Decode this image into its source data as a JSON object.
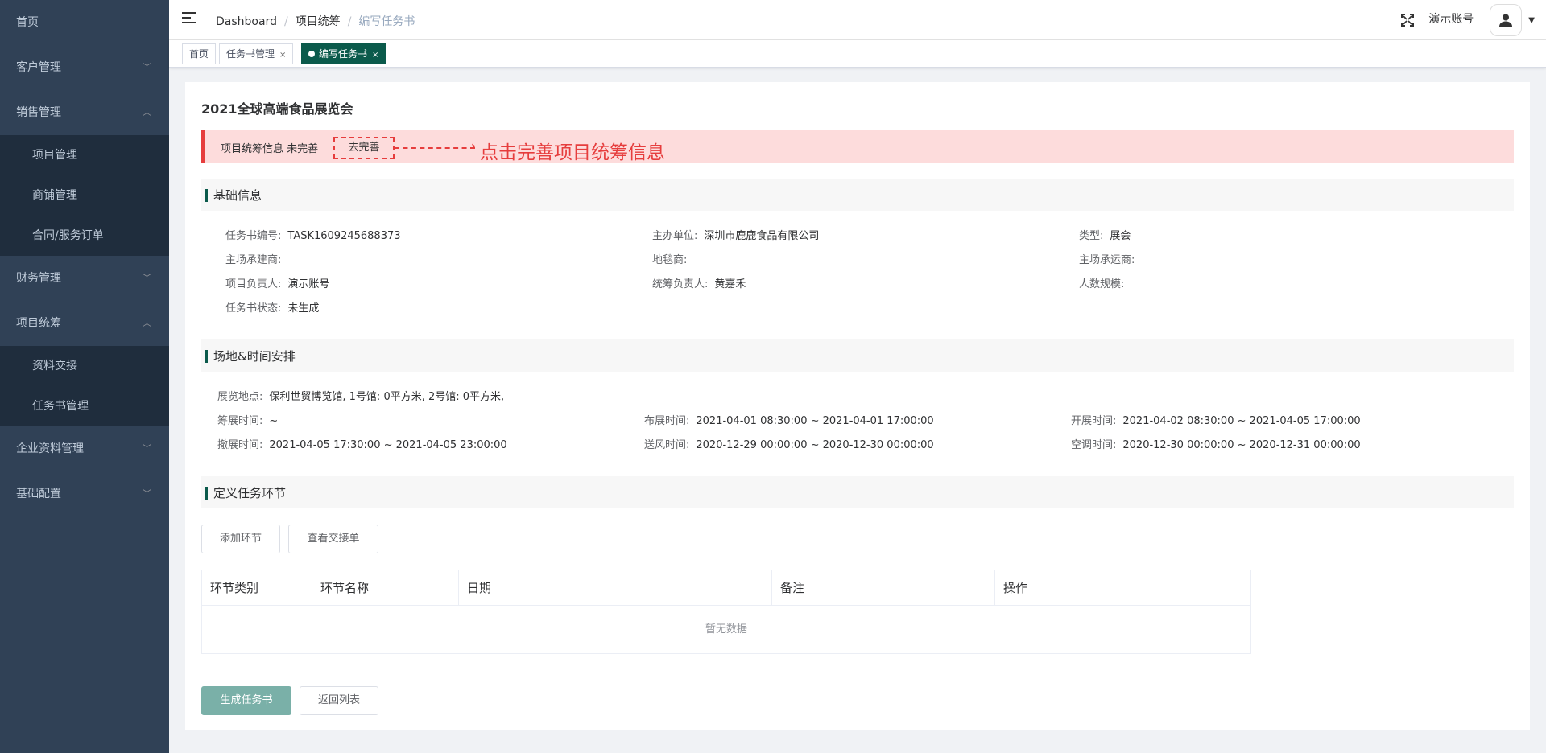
{
  "sidebar": {
    "items": [
      {
        "label": "首页"
      },
      {
        "label": "客户管理",
        "arrow": "chevron-down"
      },
      {
        "label": "销售管理",
        "arrow": "chevron-up"
      },
      {
        "label": "项目管理"
      },
      {
        "label": "商铺管理"
      },
      {
        "label": "合同/服务订单"
      },
      {
        "label": "财务管理",
        "arrow": "chevron-down"
      },
      {
        "label": "项目统筹",
        "arrow": "chevron-up"
      },
      {
        "label": "资料交接"
      },
      {
        "label": "任务书管理"
      },
      {
        "label": "企业资料管理",
        "arrow": "chevron-down"
      },
      {
        "label": "基础配置",
        "arrow": "chevron-down"
      }
    ]
  },
  "header": {
    "breadcrumb": [
      "Dashboard",
      "项目统筹",
      "编写任务书"
    ],
    "user_name": "演示账号"
  },
  "tags": [
    {
      "label": "首页"
    },
    {
      "label": "任务书管理"
    },
    {
      "label": "编写任务书"
    }
  ],
  "main": {
    "project_title": "2021全球高端食品展览会",
    "alert": {
      "text": "项目统筹信息 未完善",
      "link": "去完善",
      "annotation": "点击完善项目统筹信息"
    },
    "basic_info": {
      "title": "基础信息",
      "fields": [
        {
          "label": "任务书编号:",
          "value": "TASK1609245688373"
        },
        {
          "label": "主办单位:",
          "value": "深圳市鹿鹿食品有限公司"
        },
        {
          "label": "类型:",
          "value": "展会"
        },
        {
          "label": "主场承建商:",
          "value": ""
        },
        {
          "label": "地毯商:",
          "value": ""
        },
        {
          "label": "主场承运商:",
          "value": ""
        },
        {
          "label": "项目负责人:",
          "value": "演示账号"
        },
        {
          "label": "统筹负责人:",
          "value": "黄嘉禾"
        },
        {
          "label": "人数规模:",
          "value": ""
        },
        {
          "label": "任务书状态:",
          "value": "未生成"
        }
      ]
    },
    "venue_time": {
      "title": "场地&时间安排",
      "fields": [
        {
          "label": "展览地点:",
          "value": "保利世贸博览馆, 1号馆: 0平方米, 2号馆: 0平方米,"
        },
        {
          "label": "筹展时间:",
          "value": "~"
        },
        {
          "label": "布展时间:",
          "value": "2021-04-01 08:30:00 ~ 2021-04-01 17:00:00"
        },
        {
          "label": "开展时间:",
          "value": "2021-04-02 08:30:00 ~ 2021-04-05 17:00:00"
        },
        {
          "label": "撤展时间:",
          "value": "2021-04-05 17:30:00 ~ 2021-04-05 23:00:00"
        },
        {
          "label": "送风时间:",
          "value": "2020-12-29 00:00:00 ~ 2020-12-30 00:00:00"
        },
        {
          "label": "空调时间:",
          "value": "2020-12-30 00:00:00 ~ 2020-12-31 00:00:00"
        }
      ]
    },
    "tasks": {
      "title": "定义任务环节",
      "add_button": "添加环节",
      "view_button": "查看交接单",
      "columns": [
        "环节类别",
        "环节名称",
        "日期",
        "备注",
        "操作"
      ],
      "empty_text": "暂无数据"
    },
    "actions": {
      "generate": "生成任务书",
      "back": "返回列表"
    }
  },
  "colors": {
    "sidebar_bg": "#304156",
    "accent": "#0b5a4b",
    "alert_bg": "#fddcdc",
    "alert_red": "#e63d3d"
  }
}
